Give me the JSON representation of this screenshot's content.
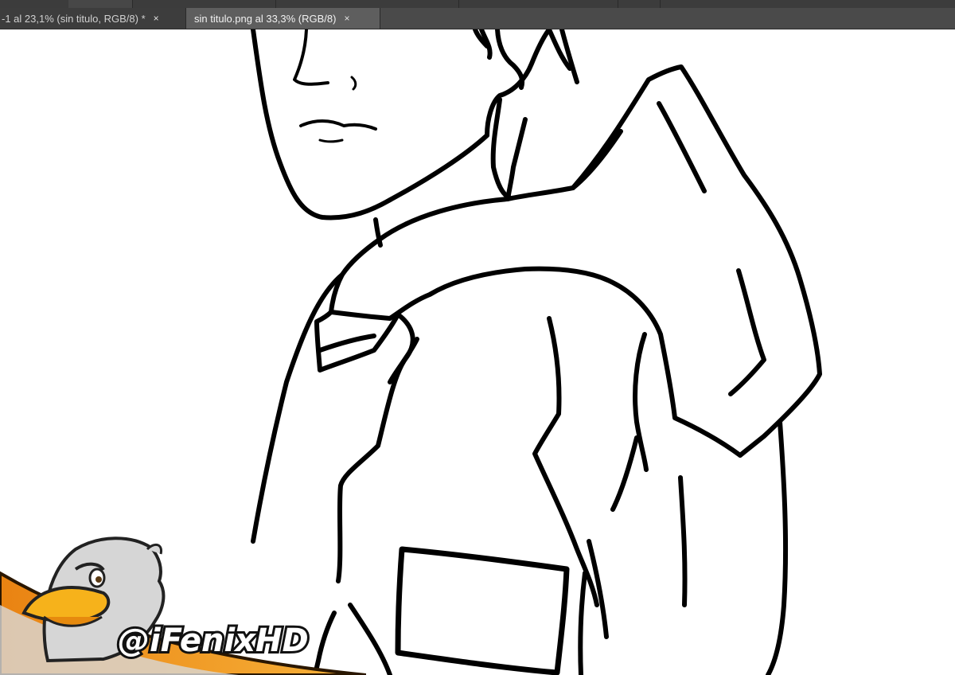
{
  "window": {
    "tabs": [
      {
        "label": "-1 al 23,1% (sin titulo, RGB/8) *",
        "active": false,
        "close": "×"
      },
      {
        "label": "sin titulo.png al 33,3% (RGB/8)",
        "active": true,
        "close": "×"
      }
    ]
  },
  "canvas": {
    "background": "#ffffff",
    "line_color": "#000000",
    "content": "line-art-drawing"
  },
  "watermark": {
    "handle": "@iFenixHD",
    "mascot_icon": "eagle-mascot-icon",
    "banner_color": "#f39a1d"
  },
  "colors": {
    "chrome_dark": "#3c3c3c",
    "tab_active": "#5e5e5e",
    "tab_inactive": "#3d3d3d",
    "tab_text": "#d0d0d0"
  }
}
